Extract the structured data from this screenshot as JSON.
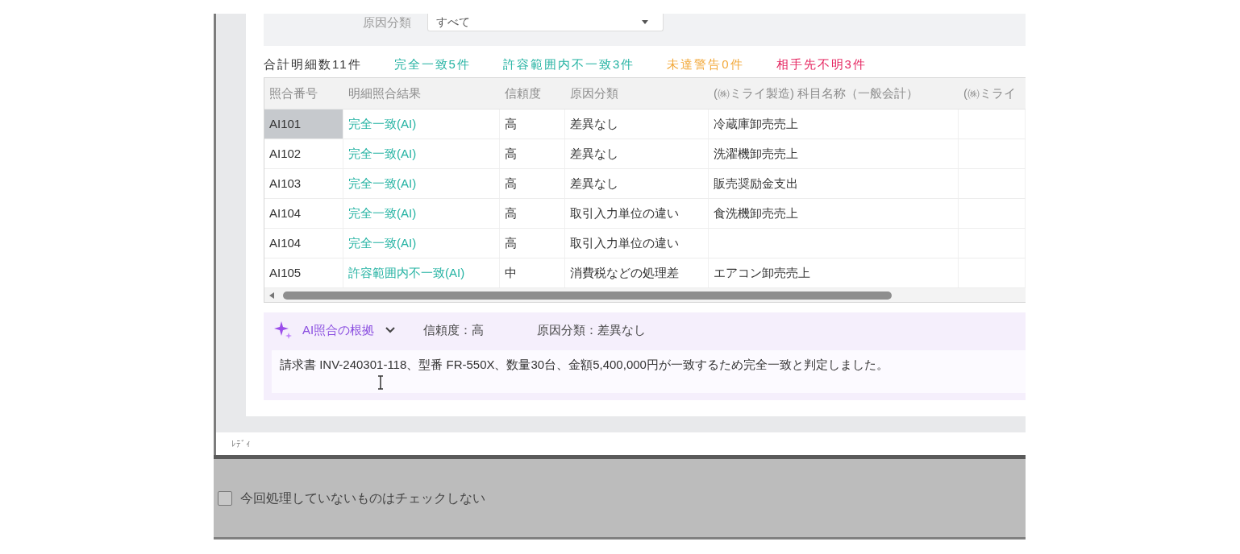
{
  "filter": {
    "label": "原因分類",
    "value": "すべて"
  },
  "summary": [
    {
      "text": "合計明細数11件",
      "color": "#333333"
    },
    {
      "text": "完全一致5件",
      "color": "#25b3a3"
    },
    {
      "text": "許容範囲内不一致3件",
      "color": "#25b3a3"
    },
    {
      "text": "未達警告0件",
      "color": "#f2a93b"
    },
    {
      "text": "相手先不明3件",
      "color": "#e5245f"
    }
  ],
  "table": {
    "columns": [
      "照合番号",
      "明細照合結果",
      "信頼度",
      "原因分類",
      "(㈱ミライ製造) 科目名称（一般会計）",
      "(㈱ミライ"
    ],
    "rows": [
      {
        "number": "AI101",
        "result": "完全一致(AI)",
        "confidence": "高",
        "cause": "差異なし",
        "account": "冷蔵庫卸売売上",
        "selected": true
      },
      {
        "number": "AI102",
        "result": "完全一致(AI)",
        "confidence": "高",
        "cause": "差異なし",
        "account": "洗濯機卸売売上",
        "selected": false
      },
      {
        "number": "AI103",
        "result": "完全一致(AI)",
        "confidence": "高",
        "cause": "差異なし",
        "account": "販売奨励金支出",
        "selected": false
      },
      {
        "number": "AI104",
        "result": "完全一致(AI)",
        "confidence": "高",
        "cause": "取引入力単位の違い",
        "account": "食洗機卸売売上",
        "selected": false
      },
      {
        "number": "AI104",
        "result": "完全一致(AI)",
        "confidence": "高",
        "cause": "取引入力単位の違い",
        "selected": false
      },
      {
        "number": "AI105",
        "result": "許容範囲内不一致(AI)",
        "confidence": "中",
        "cause": "消費税などの処理差",
        "account": "エアコン卸売売上",
        "selected": false
      }
    ]
  },
  "reason": {
    "title": "AI照合の根拠",
    "expanded": true,
    "confidence": "信頼度：高",
    "cause": "原因分類：差異なし",
    "text": "請求書 INV-240301-118、型番 FR-550X、数量30台、金額5,400,000円が一致するため完全一致と判定しました。"
  },
  "status_bar": {
    "text": "ﾚﾃﾞｨ"
  },
  "footer": {
    "checkbox": {
      "label": "今回処理していないものはチェックしない",
      "checked": false
    }
  }
}
